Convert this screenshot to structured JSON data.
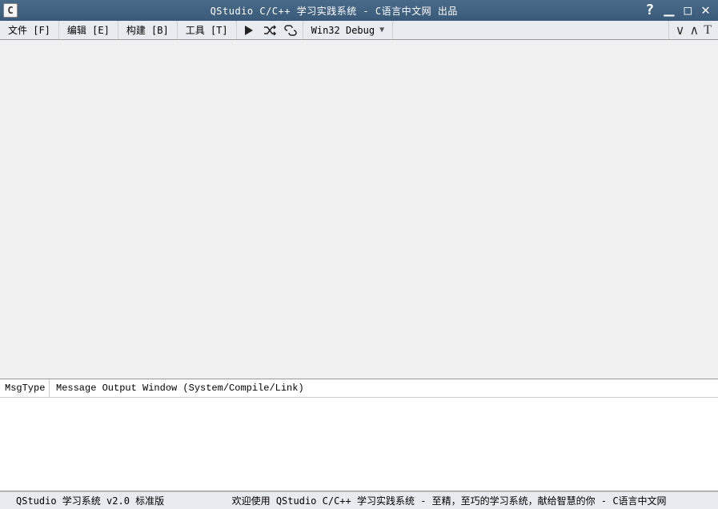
{
  "titlebar": {
    "icon_letter": "C",
    "title": "QStudio C/C++ 学习实践系统 - C语言中文网 出品"
  },
  "menubar": {
    "items": [
      {
        "label": "文件 [F]"
      },
      {
        "label": "编辑 [E]"
      },
      {
        "label": "构建 [B]"
      },
      {
        "label": "工具 [T]"
      }
    ],
    "config": "Win32 Debug"
  },
  "output": {
    "msgtype_header": "MsgType",
    "message_header": "Message Output Window (System/Compile/Link)"
  },
  "statusbar": {
    "version": "QStudio 学习系统 v2.0 标准版",
    "welcome": "欢迎使用 QStudio C/C++ 学习实践系统 - 至精，至巧的学习系统，献给智慧的你 - C语言中文网"
  }
}
